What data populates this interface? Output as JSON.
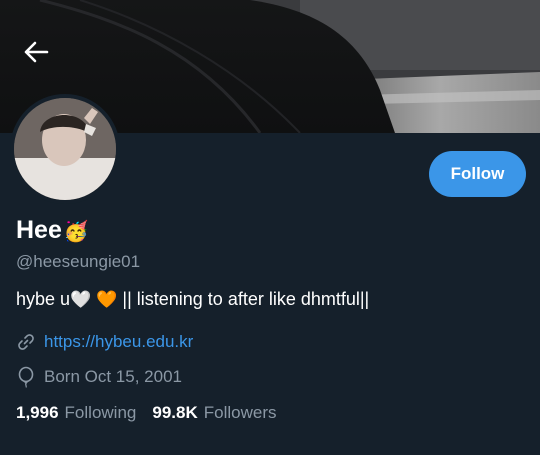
{
  "profile": {
    "display_name": "Hee",
    "name_emoji": "🥳",
    "handle": "@heeseungie01",
    "bio_prefix": "hybe u",
    "bio_heart_white": "🤍",
    "bio_heart_orange": "🧡",
    "bio_suffix": " || listening to after like dhmtful||",
    "website": "https://hybeu.edu.kr",
    "born": "Born Oct 15, 2001"
  },
  "actions": {
    "follow_label": "Follow"
  },
  "stats": {
    "following_count": "1,996",
    "following_label": "Following",
    "followers_count": "99.8K",
    "followers_label": "Followers"
  },
  "icons": {
    "back": "back-arrow-icon",
    "link": "link-icon",
    "birthday": "balloon-icon"
  },
  "colors": {
    "background": "#15202b",
    "accent": "#3b96e8",
    "muted_text": "#8b98a5",
    "text": "#ffffff"
  }
}
